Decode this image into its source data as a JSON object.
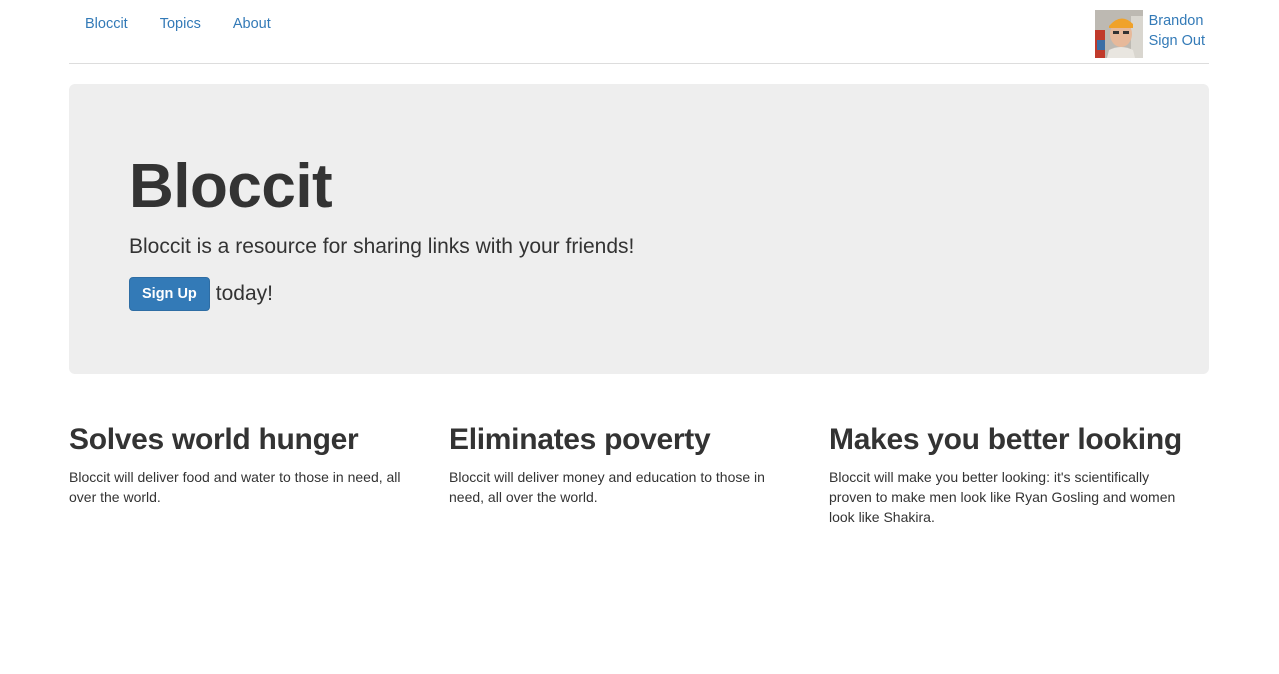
{
  "nav": {
    "links": [
      {
        "label": "Bloccit"
      },
      {
        "label": "Topics"
      },
      {
        "label": "About"
      }
    ]
  },
  "user": {
    "name": "Brandon",
    "sign_out": "Sign Out",
    "avatar_icon": "user-avatar-photo"
  },
  "jumbotron": {
    "title": "Bloccit",
    "lead": "Bloccit is a resource for sharing links with your friends!",
    "signup_label": "Sign Up",
    "signup_suffix": "today!"
  },
  "features": [
    {
      "title": "Solves world hunger",
      "text": "Bloccit will deliver food and water to those in need, all over the world."
    },
    {
      "title": "Eliminates poverty",
      "text": "Bloccit will deliver money and education to those in need, all over the world."
    },
    {
      "title": "Makes you better looking",
      "text": "Bloccit will make you better looking: it's scientifically proven to make men look like Ryan Gosling and women look like Shakira."
    }
  ],
  "colors": {
    "link": "#337ab7",
    "primary_button": "#337ab7",
    "jumbotron_bg": "#eeeeee",
    "text": "#333333"
  }
}
